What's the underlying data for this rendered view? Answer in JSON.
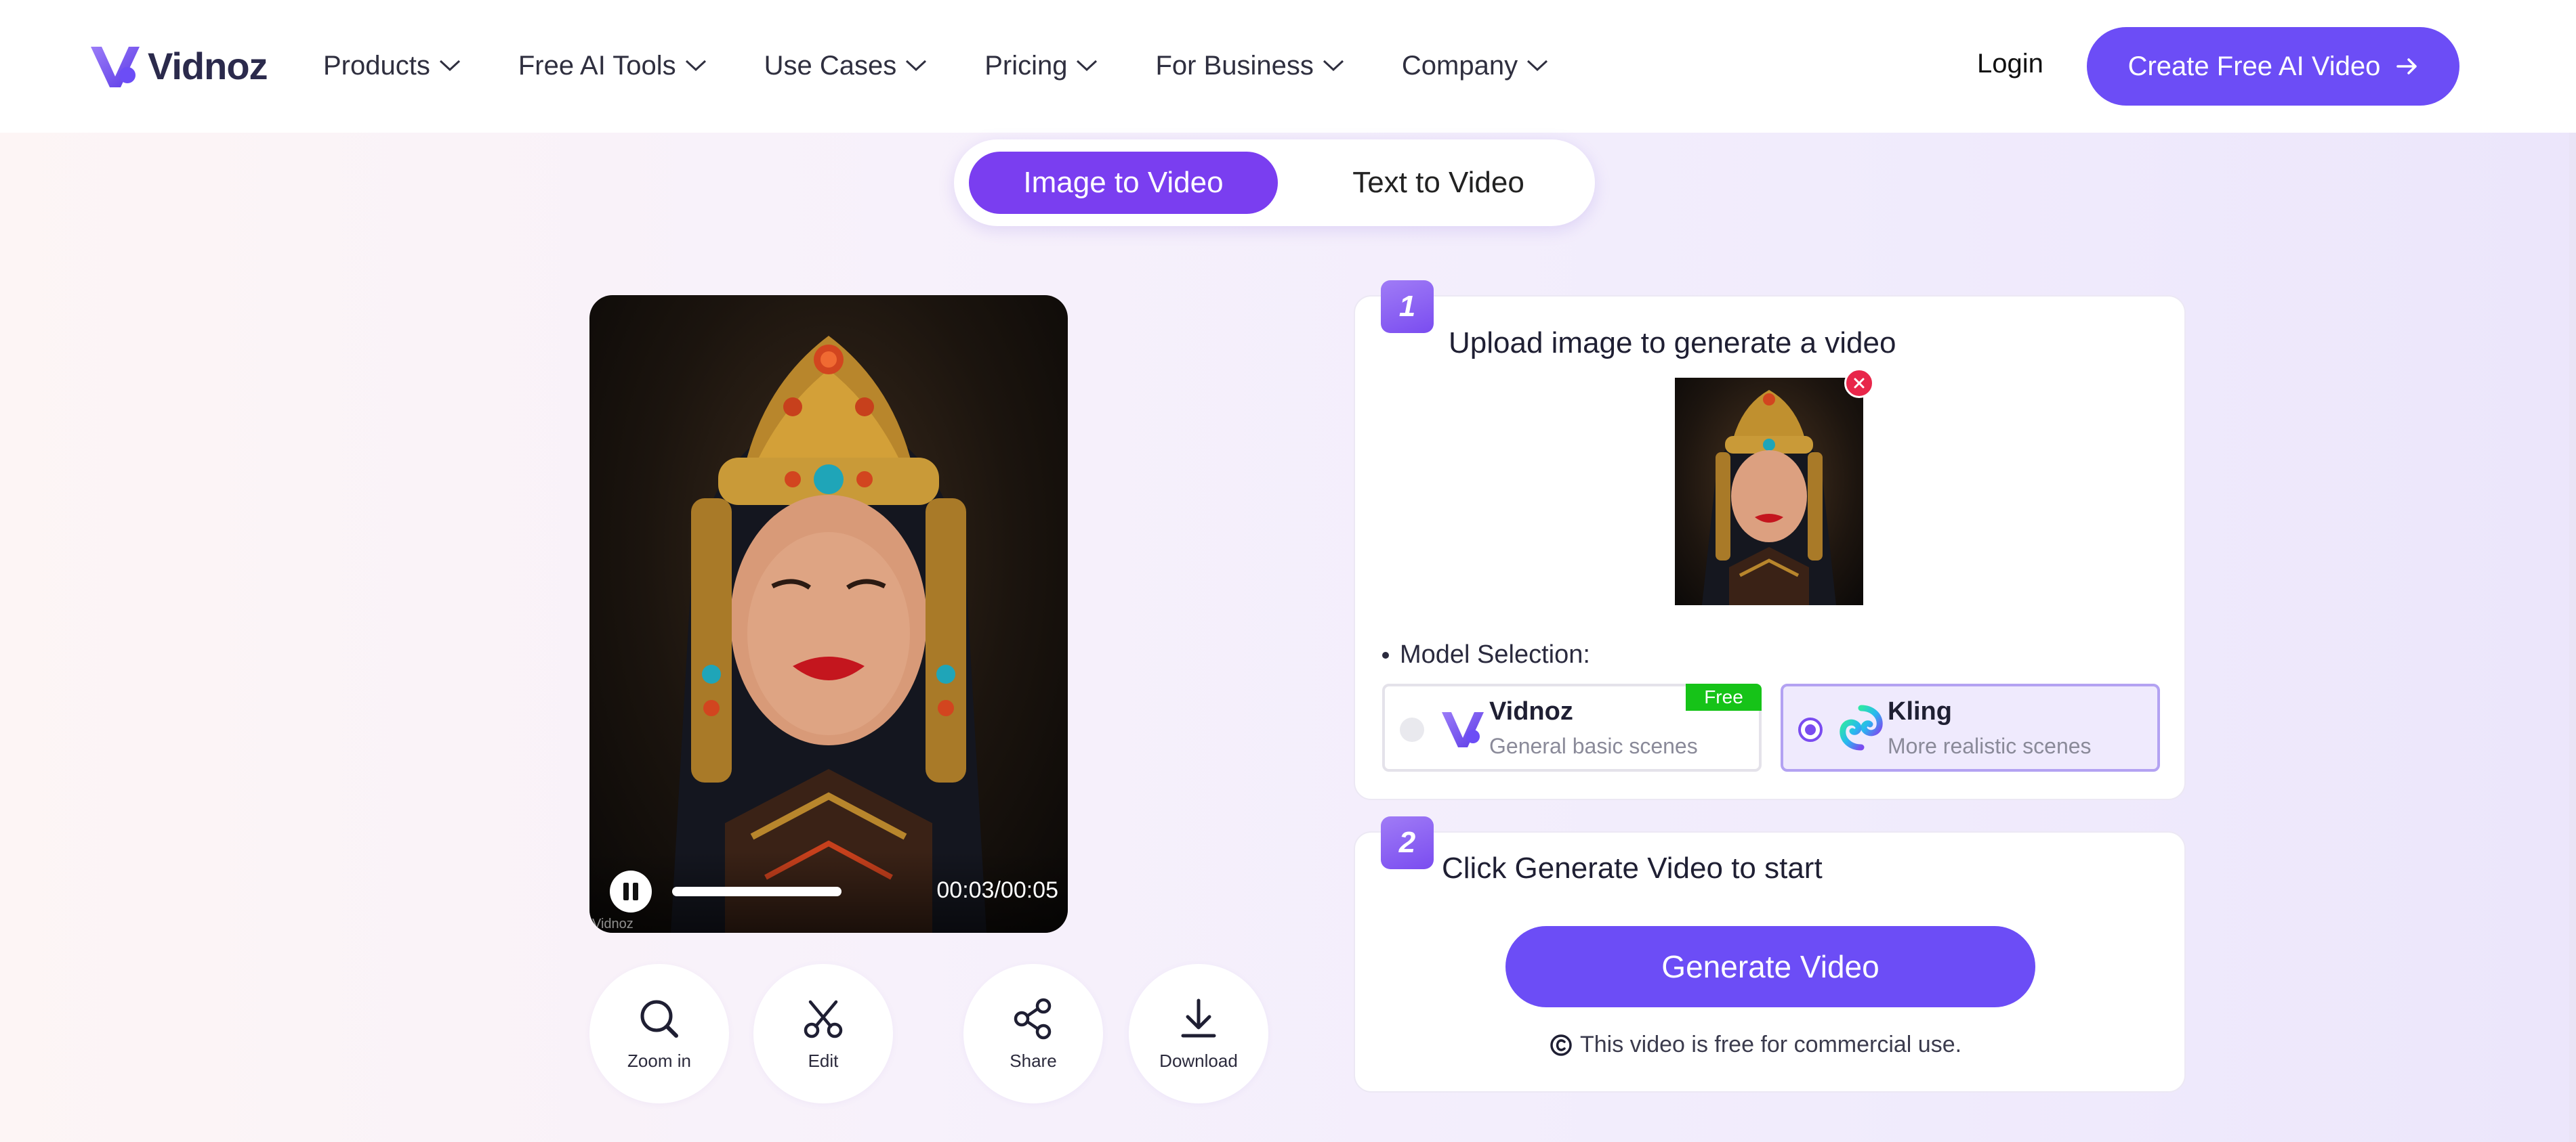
{
  "brand": {
    "name": "Vidnoz",
    "accent": "#6c4df6",
    "toggle_active": "#7a3ef0"
  },
  "nav": {
    "items": [
      {
        "label": "Products"
      },
      {
        "label": "Free AI Tools"
      },
      {
        "label": "Use Cases"
      },
      {
        "label": "Pricing"
      },
      {
        "label": "For Business"
      },
      {
        "label": "Company"
      }
    ],
    "login": "Login",
    "cta": "Create Free AI Video"
  },
  "mode_toggle": {
    "active": "Image to Video",
    "inactive": "Text to Video"
  },
  "player": {
    "timecode": "00:03/00:05",
    "watermark": "Vidnoz",
    "progress": 0.6
  },
  "actions": [
    {
      "label": "Zoom in",
      "icon": "zoom-in-icon"
    },
    {
      "label": "Edit",
      "icon": "scissors-icon"
    },
    {
      "label": "Share",
      "icon": "share-icon"
    },
    {
      "label": "Download",
      "icon": "download-icon"
    }
  ],
  "step1": {
    "number": "1",
    "title": "Upload image to generate a video",
    "model_label": "Model Selection:",
    "models": [
      {
        "name": "Vidnoz",
        "desc": "General basic scenes",
        "badge": "Free",
        "selected": false
      },
      {
        "name": "Kling",
        "desc": "More realistic scenes",
        "selected": true
      }
    ]
  },
  "step2": {
    "number": "2",
    "title": "Click Generate Video to start",
    "button": "Generate Video",
    "note": "This video is free for commercial use."
  }
}
